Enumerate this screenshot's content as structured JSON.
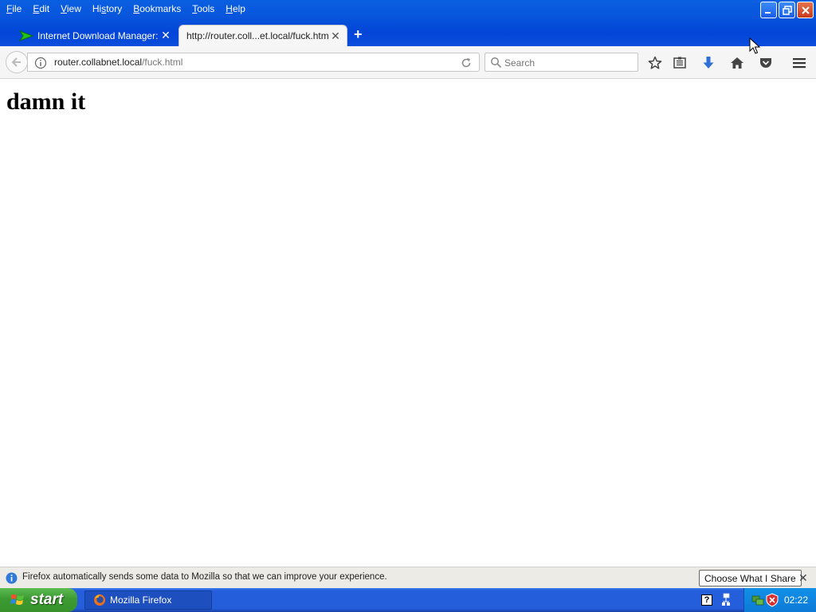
{
  "menu": [
    "File",
    "Edit",
    "View",
    "History",
    "Bookmarks",
    "Tools",
    "Help"
  ],
  "menu_underline": [
    "F",
    "E",
    "V",
    "s",
    "B",
    "T",
    "H"
  ],
  "tabs": [
    {
      "label": "Internet Download Manager: ...",
      "active": false
    },
    {
      "label": "http://router.coll...et.local/fuck.html",
      "active": true
    }
  ],
  "new_tab_glyph": "+",
  "address": {
    "host": "router.collabnet.local",
    "path": "/fuck.html"
  },
  "search": {
    "placeholder": "Search"
  },
  "toolbar_icons": [
    "bookmark-star-icon",
    "reading-list-icon",
    "download-icon",
    "home-icon",
    "pocket-icon",
    "menu-icon"
  ],
  "page": {
    "heading": "damn it"
  },
  "notification": {
    "text": "Firefox automatically sends some data to Mozilla so that we can improve your experience.",
    "button": "Choose What I Share"
  },
  "taskbar": {
    "start": "start",
    "task": "Mozilla Firefox",
    "clock": "02:22"
  },
  "colors": {
    "titlebar": "#0855dc",
    "taskbar": "#245edb",
    "start": "#3c9a32",
    "accent_download": "#2f6fd6"
  }
}
